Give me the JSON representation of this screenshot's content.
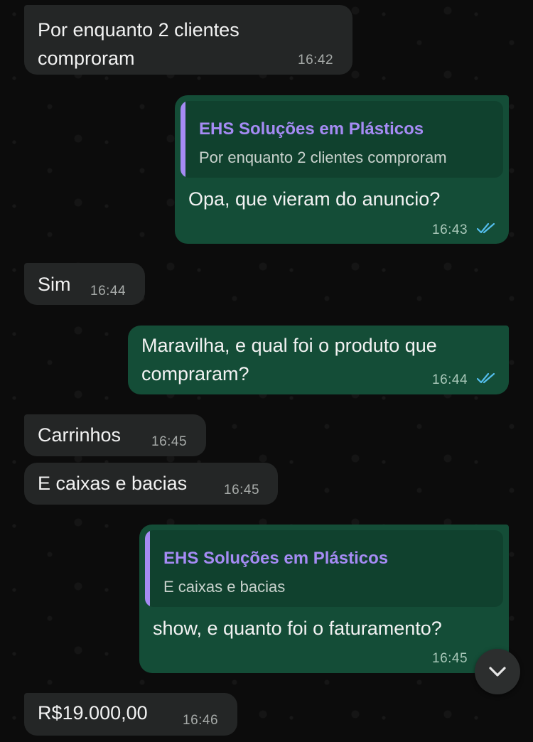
{
  "chat": {
    "messages": [
      {
        "direction": "incoming",
        "text": "Por enquanto 2 clientes\ncomproram",
        "time": "16:42"
      },
      {
        "direction": "outgoing",
        "quote": {
          "author": "EHS Soluções em Plásticos",
          "text": "Por enquanto 2 clientes comproram"
        },
        "text": "Opa, que vieram do anuncio?",
        "time": "16:43",
        "status": "read"
      },
      {
        "direction": "incoming",
        "text": "Sim",
        "time": "16:44"
      },
      {
        "direction": "outgoing",
        "text": "Maravilha, e qual foi o produto que\ncompraram?",
        "time": "16:44",
        "status": "read"
      },
      {
        "direction": "incoming",
        "text": "Carrinhos",
        "time": "16:45"
      },
      {
        "direction": "incoming",
        "text": "E caixas e bacias",
        "time": "16:45"
      },
      {
        "direction": "outgoing",
        "quote": {
          "author": "EHS Soluções em Plásticos",
          "text": "E caixas e bacias"
        },
        "text": "show, e quanto foi o faturamento?",
        "time": "16:45"
      },
      {
        "direction": "incoming",
        "text": "R$19.000,00",
        "time": "16:46"
      }
    ]
  },
  "scroll_down_icon": "chevron-down-icon",
  "colors": {
    "incoming_bubble": "#242626",
    "outgoing_bubble": "#144d37",
    "quote_accent": "#a58bf4",
    "read_ticks": "#53bdeb"
  }
}
